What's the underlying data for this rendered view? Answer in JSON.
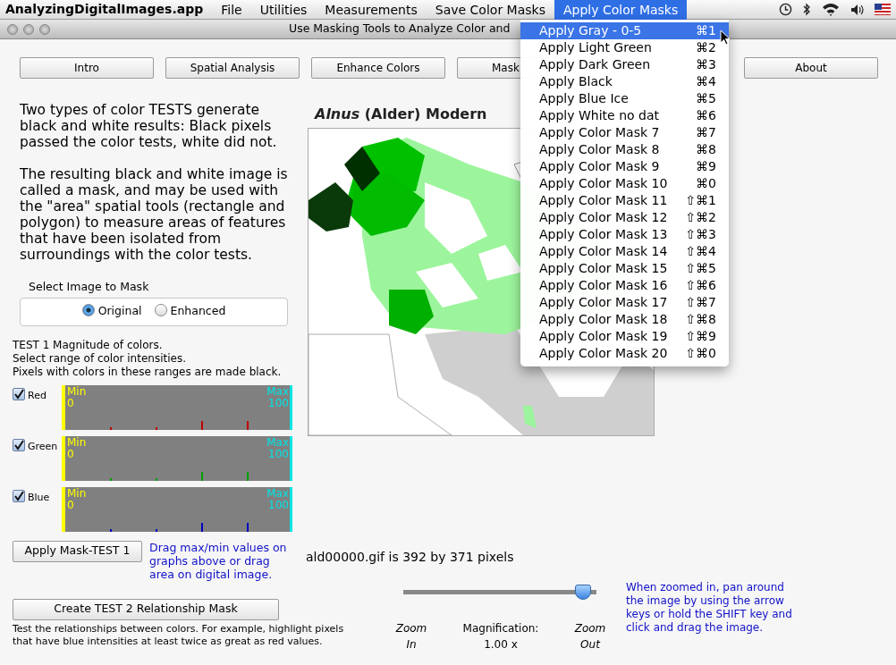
{
  "menu_bar": {
    "app_name": "AnalyzingDigitalImages.app",
    "menus": [
      {
        "label": "File",
        "selected": false
      },
      {
        "label": "Utilities",
        "selected": false
      },
      {
        "label": "Measurements",
        "selected": false
      },
      {
        "label": "Save Color Masks",
        "selected": false
      },
      {
        "label": "Apply Color Masks",
        "selected": true
      }
    ]
  },
  "window": {
    "title": "Use Masking Tools to Analyze Color and"
  },
  "nav_buttons": [
    {
      "label": "Intro"
    },
    {
      "label": "Spatial Analysis"
    },
    {
      "label": "Enhance Colors"
    },
    {
      "label": "Mask",
      "cut_by_menu": true
    },
    {
      "label": "About"
    }
  ],
  "intro_paragraphs": [
    "Two types of color TESTS generate black and white results: Black pixels passed the color tests, white did not.",
    "The resulting black and white image is called a mask, and may be used with the \"area\" spatial tools (rectangle and polygon) to measure areas of features that have been isolated from surroundings with the color tests."
  ],
  "image_select": {
    "label": "Select Image to Mask",
    "options": [
      {
        "label": "Original",
        "selected": true
      },
      {
        "label": "Enhanced",
        "selected": false
      }
    ]
  },
  "test1": {
    "lines": [
      "TEST 1 Magnitude of colors.",
      "Select range of color intensities.",
      "Pixels with colors in these ranges are made black."
    ],
    "channels": [
      {
        "name": "Red",
        "checked": true,
        "color": "#c00000",
        "min_label": "Min",
        "min_value": "0",
        "max_label": "Max",
        "max_value": "100"
      },
      {
        "name": "Green",
        "checked": true,
        "color": "#00a000",
        "min_label": "Min",
        "min_value": "0",
        "max_label": "Max",
        "max_value": "100"
      },
      {
        "name": "Blue",
        "checked": true,
        "color": "#0000c0",
        "min_label": "Min",
        "min_value": "0",
        "max_label": "Max",
        "max_value": "100"
      }
    ],
    "apply_button": "Apply Mask-TEST 1",
    "hint": "Drag max/min values on graphs above or drag area on digital image."
  },
  "test2": {
    "button": "Create TEST 2 Relationship Mask",
    "description": "Test the relationships between colors.  For example, highlight pixels that have blue intensities at least twice as great as red values."
  },
  "map": {
    "title": "*Alnus* (Alder) Modern",
    "file_info": "ald00000.gif is 392 by 371 pixels"
  },
  "zoom": {
    "level": 0.97,
    "zoom_in": "Zoom In",
    "zoom_out": "Zoom Out",
    "magnification_label": "Magnification:",
    "magnification_value": "1.00 x",
    "hint": "When zoomed in, pan around the image by using the arrow keys or hold the SHIFT key and click and drag the image."
  },
  "dropdown": {
    "items": [
      {
        "label": "Apply Gray - 0-5",
        "shortcut": "⌘1",
        "selected": true
      },
      {
        "label": "Apply Light Green",
        "shortcut": "⌘2",
        "selected": false
      },
      {
        "label": "Apply Dark Green",
        "shortcut": "⌘3",
        "selected": false
      },
      {
        "label": "Apply Black",
        "shortcut": "⌘4",
        "selected": false
      },
      {
        "label": "Apply Blue Ice",
        "shortcut": "⌘5",
        "selected": false
      },
      {
        "label": "Apply White no dat",
        "shortcut": "⌘6",
        "selected": false
      },
      {
        "label": "Apply Color Mask 7",
        "shortcut": "⌘7",
        "selected": false
      },
      {
        "label": "Apply Color Mask 8",
        "shortcut": "⌘8",
        "selected": false
      },
      {
        "label": "Apply Color Mask 9",
        "shortcut": "⌘9",
        "selected": false
      },
      {
        "label": "Apply Color Mask 10",
        "shortcut": "⌘0",
        "selected": false
      },
      {
        "label": "Apply Color Mask 11",
        "shortcut": "⇧⌘1",
        "selected": false
      },
      {
        "label": "Apply Color Mask 12",
        "shortcut": "⇧⌘2",
        "selected": false
      },
      {
        "label": "Apply Color Mask 13",
        "shortcut": "⇧⌘3",
        "selected": false
      },
      {
        "label": "Apply Color Mask 14",
        "shortcut": "⇧⌘4",
        "selected": false
      },
      {
        "label": "Apply Color Mask 15",
        "shortcut": "⇧⌘5",
        "selected": false
      },
      {
        "label": "Apply Color Mask 16",
        "shortcut": "⇧⌘6",
        "selected": false
      },
      {
        "label": "Apply Color Mask 17",
        "shortcut": "⇧⌘7",
        "selected": false
      },
      {
        "label": "Apply Color Mask 18",
        "shortcut": "⇧⌘8",
        "selected": false
      },
      {
        "label": "Apply Color Mask 19",
        "shortcut": "⇧⌘9",
        "selected": false
      },
      {
        "label": "Apply Color Mask 20",
        "shortcut": "⇧⌘0",
        "selected": false
      }
    ]
  }
}
